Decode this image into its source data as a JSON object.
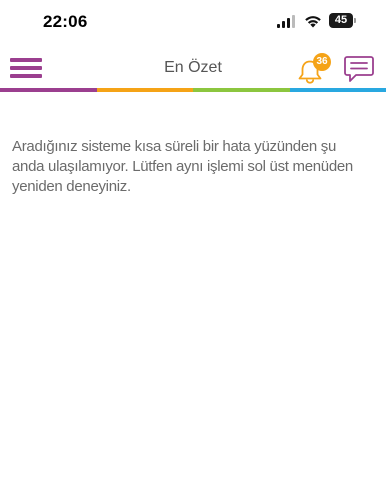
{
  "status_bar": {
    "time": "22:06",
    "battery": "45",
    "signal_icon": "cellular-signal-icon",
    "wifi_icon": "wifi-icon",
    "battery_icon": "battery-icon"
  },
  "header": {
    "title": "En Özet",
    "menu_icon": "hamburger-menu-icon",
    "notification_icon": "bell-icon",
    "notification_count": "36",
    "message_icon": "chat-bubble-icon"
  },
  "colors": {
    "menu": "#9b3f8f",
    "bell": "#f5a317",
    "chat": "#9b3f8f",
    "badge": "#f5a317",
    "strip": [
      "#9b3f8f",
      "#f5a317",
      "#8cc63f",
      "#29a8e0"
    ],
    "text": "#6b6b6b",
    "title": "#555555"
  },
  "content": {
    "error_message": "Aradığınız sisteme kısa süreli bir hata yüzünden şu\nanda ulaşılamıyor.  Lütfen aynı işlemi sol üst menüden\nyeniden deneyiniz."
  }
}
